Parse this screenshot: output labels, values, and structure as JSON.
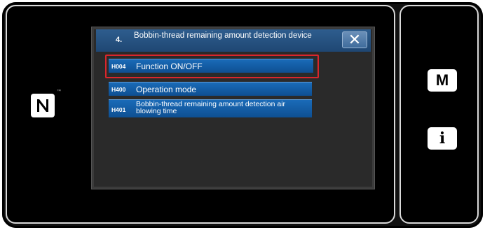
{
  "dialog": {
    "number": "4.",
    "title": "Bobbin-thread remaining amount detection device",
    "close_icon": "close-icon"
  },
  "menu": {
    "items": [
      {
        "code": "H004",
        "label": "Function ON/OFF"
      },
      {
        "code": "H400",
        "label": "Operation mode"
      },
      {
        "code": "H401",
        "label": "Bobbin-thread remaining amount detection air blowing time"
      }
    ]
  },
  "side_buttons": {
    "m_label": "M",
    "i_label": "i"
  },
  "nfc": {
    "icon": "nfc-icon",
    "trademark": "™"
  },
  "colors": {
    "highlight": "#d9262c",
    "menu_blue": "#1a6bb8",
    "titlebar_blue": "#2e5d8e"
  }
}
